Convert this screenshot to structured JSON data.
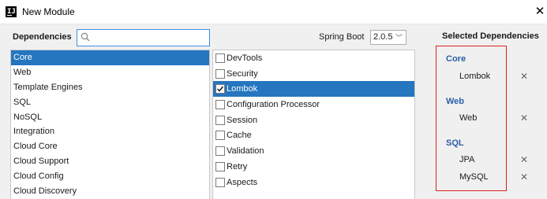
{
  "window": {
    "title": "New Module",
    "close_glyph": "✕"
  },
  "dependencies": {
    "label": "Dependencies",
    "search_value": "",
    "search_placeholder": ""
  },
  "spring_boot": {
    "label": "Spring Boot",
    "version": "2.0.5"
  },
  "categories": [
    "Core",
    "Web",
    "Template Engines",
    "SQL",
    "NoSQL",
    "Integration",
    "Cloud Core",
    "Cloud Support",
    "Cloud Config",
    "Cloud Discovery"
  ],
  "selected_category_index": 0,
  "dependency_items": [
    {
      "label": "DevTools",
      "checked": false,
      "selected": false
    },
    {
      "label": "Security",
      "checked": false,
      "selected": false
    },
    {
      "label": "Lombok",
      "checked": true,
      "selected": true
    },
    {
      "label": "Configuration Processor",
      "checked": false,
      "selected": false
    },
    {
      "label": "Session",
      "checked": false,
      "selected": false
    },
    {
      "label": "Cache",
      "checked": false,
      "selected": false
    },
    {
      "label": "Validation",
      "checked": false,
      "selected": false
    },
    {
      "label": "Retry",
      "checked": false,
      "selected": false
    },
    {
      "label": "Aspects",
      "checked": false,
      "selected": false
    }
  ],
  "selected_dependencies": {
    "title": "Selected Dependencies",
    "groups": [
      {
        "name": "Core",
        "items": [
          "Lombok"
        ]
      },
      {
        "name": "Web",
        "items": [
          "Web"
        ]
      },
      {
        "name": "SQL",
        "items": [
          "JPA",
          "MySQL"
        ]
      }
    ],
    "remove_glyph": "✕"
  },
  "colors": {
    "selection": "#2675bf",
    "group_heading": "#2a5ca8",
    "highlight_border": "#e02020",
    "search_focus": "#3d8ee0"
  },
  "icons": {
    "app": "intellij-icon",
    "search": "search-icon",
    "close": "close-icon"
  }
}
